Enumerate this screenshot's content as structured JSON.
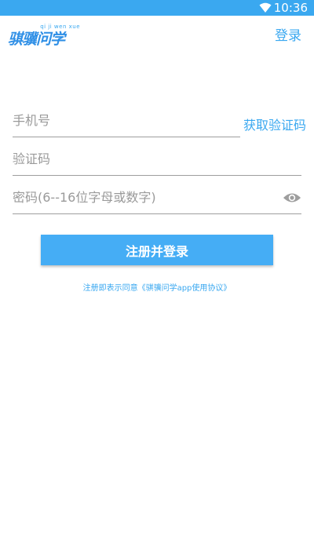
{
  "status_bar": {
    "time": "10:36",
    "wifi_icon": "wifi-icon",
    "background": "#3aa8f0"
  },
  "header": {
    "logo_text": "骐骥问学",
    "logo_tag": "qi ji wen xue",
    "login_label": "登录"
  },
  "form": {
    "phone_placeholder": "手机号",
    "get_code_label": "获取验证码",
    "code_placeholder": "验证码",
    "password_placeholder": "密码(6--16位字母或数字)",
    "visibility_icon": "eye-icon"
  },
  "register_button": {
    "label": "注册并登录"
  },
  "agreement": {
    "prefix": "注册即表示同意",
    "link": "《骐骥问学app使用协议》"
  },
  "colors": {
    "accent": "#3aa8f0",
    "button": "#45adf5"
  }
}
